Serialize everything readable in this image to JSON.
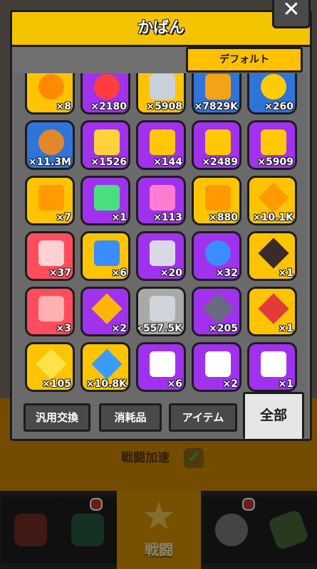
{
  "modal": {
    "title": "かばん",
    "close_label": "✕",
    "sort_label": "デフォルト"
  },
  "colors": {
    "yellow": "#ffc400",
    "purple": "#a032ee",
    "blue": "#2f74d8",
    "red": "#ff4d5e",
    "gray": "#a9a9a9"
  },
  "items": [
    {
      "qty": "×8",
      "bg": "yellow",
      "icon": "orange-orb-icon",
      "color": "#ff8a00"
    },
    {
      "qty": "×2180",
      "bg": "purple",
      "icon": "heart-orb-icon",
      "color": "#ff3d3d"
    },
    {
      "qty": "×5908",
      "bg": "yellow",
      "icon": "silver-key-icon",
      "color": "#c9d1dc"
    },
    {
      "qty": "×7829K",
      "bg": "blue",
      "icon": "droplet-icon",
      "color": "#f3a316"
    },
    {
      "qty": "×260",
      "bg": "blue",
      "icon": "gold-coin-icon",
      "color": "#ffcc00"
    },
    {
      "qty": "×11.3M",
      "bg": "blue",
      "icon": "lion-coin-icon",
      "color": "#e0892a"
    },
    {
      "qty": "×1526",
      "bg": "purple",
      "icon": "gold-ticket-icon",
      "color": "#ffd23a"
    },
    {
      "qty": "×144",
      "bg": "purple",
      "icon": "gold-key-icon",
      "color": "#ffc700"
    },
    {
      "qty": "×2489",
      "bg": "purple",
      "icon": "hex-key-icon",
      "color": "#ffc700"
    },
    {
      "qty": "×5909",
      "bg": "purple",
      "icon": "gold-hex-key-icon",
      "color": "#ffc700"
    },
    {
      "qty": "×7",
      "bg": "yellow",
      "icon": "treasure-chest-icon",
      "color": "#ff9a00"
    },
    {
      "qty": "×1",
      "bg": "purple",
      "icon": "emerald-card-icon",
      "color": "#4adf7e"
    },
    {
      "qty": "×113",
      "bg": "purple",
      "icon": "pink-gift-icon",
      "color": "#ff7cd0"
    },
    {
      "qty": "×880",
      "bg": "yellow",
      "icon": "gold-gift-icon",
      "color": "#ff9a00"
    },
    {
      "qty": "×10.1K",
      "bg": "yellow",
      "icon": "star-crystal-icon",
      "color": "#ff9a00"
    },
    {
      "qty": "×37",
      "bg": "red",
      "icon": "red-gift-icon",
      "color": "#ffd1d1"
    },
    {
      "qty": "×6",
      "bg": "yellow",
      "icon": "capsule-icon",
      "color": "#3a8cff"
    },
    {
      "qty": "×20",
      "bg": "purple",
      "icon": "purple-chest-icon",
      "color": "#d9d9e6"
    },
    {
      "qty": "×32",
      "bg": "purple",
      "icon": "v-token-icon",
      "color": "#3a8cff"
    },
    {
      "qty": "×1",
      "bg": "yellow",
      "icon": "dark-crystal-icon",
      "color": "#3b2a2a"
    },
    {
      "qty": "×3",
      "bg": "red",
      "icon": "vending-machine-icon",
      "color": "#ffb0b0"
    },
    {
      "qty": "×2",
      "bg": "purple",
      "icon": "star-ticket-icon",
      "color": "#ffb400"
    },
    {
      "qty": "×557.5K",
      "bg": "gray",
      "icon": "cube-block-icon",
      "color": "#cfd4da"
    },
    {
      "qty": "×205",
      "bg": "purple",
      "icon": "dark-shard-icon",
      "color": "#6a6a80"
    },
    {
      "qty": "×1",
      "bg": "yellow",
      "icon": "red-triangle-icon",
      "color": "#e23b3b"
    },
    {
      "qty": "×105",
      "bg": "yellow",
      "icon": "sparkle-star-icon",
      "color": "#ffe14a"
    },
    {
      "qty": "×10.8K",
      "bg": "yellow",
      "icon": "blue-gem-icon",
      "color": "#3a9bff"
    },
    {
      "qty": "×6",
      "bg": "purple",
      "icon": "puzzle-piece-icon",
      "color": "#ffffff"
    },
    {
      "qty": "×2",
      "bg": "purple",
      "icon": "puzzle-piece-icon",
      "color": "#ffffff"
    },
    {
      "qty": "×1",
      "bg": "purple",
      "icon": "puzzle-piece-icon",
      "color": "#ffffff"
    }
  ],
  "tabs": [
    {
      "label": "汎用交換",
      "active": false
    },
    {
      "label": "消耗品",
      "active": false
    },
    {
      "label": "アイテム",
      "active": false
    },
    {
      "label": "全部",
      "active": true
    }
  ],
  "background": {
    "boost_label": "戦闘加速",
    "boost_check": "✓",
    "battle_label": "戦闘",
    "battle_icon": "★"
  },
  "nav": {
    "slots": [
      {
        "icon": "shop-icon",
        "color": "#c0392b"
      },
      {
        "icon": "shield-icon",
        "color": "#2e8b57"
      },
      {
        "icon": "skull-icon",
        "color": "#cccccc"
      },
      {
        "icon": "card-pack-icon",
        "color": "#6aa84f"
      }
    ]
  }
}
